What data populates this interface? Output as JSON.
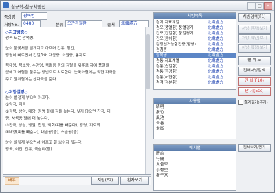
{
  "window": {
    "title": "침구학-침구처방집",
    "minimize": "_",
    "maximize": "□",
    "close": "×"
  },
  "form": {
    "name_label": "증상명",
    "name_value": "광목병",
    "no_label": "처방No.",
    "no_value": "0480",
    "category_label": "분류",
    "category_value": "오관과질환",
    "source_label": "출처",
    "source_value": "北織處方"
  },
  "content": {
    "sec1_title": "◇지표병증◇",
    "sec1_lines": [
      "광목 또는 광목병.",
      "눈이 불꽃처럼 빨개지고 아프며 간유, 행간,",
      "광명이 빠르면서 간열하며 대응증, 소원증, 통자로.",
      "목태양, 목소양, 수양명, 족궐음 경의 침혈을 위주로 하여 풍열을",
      "없애고 어혈을 풀주는 방법으로 치료한다. 눈국소혈에는 약한 자극을",
      "주고 원위혈에는 센자극을 준다."
    ],
    "sec2_title": "◇처방설명◇",
    "sec2_lines": [
      "눈이 벌겋게 부으며 아프다.",
      "①양곡, 지음",
      "②광목, 상양, 태양, 정명 혈에 침을 놓는다. 낮지 않으면 찬곡, 태",
      "양, 사목공 혈에 더 놓는다.",
      "③찬곡, 상성, 냉원, 천정, 백회(피를 빼준다), 광명, 지오회",
      "④태양(피를 빼준다), 대골공(뜸), 소골공(뜸)",
      "눈이 벌겋게 부으면서 아프고 잘 보이지 않는다.",
      "광목, 이간, 간유, 족삼리(침)"
    ]
  },
  "bottom": {
    "tag": "배우",
    "save_button": "저장(F2)",
    "list_button": "환자보기"
  },
  "list_panel": {
    "header": "처방목록",
    "rows": [
      {
        "name": "경기 지표계열",
        "source": "北織處方"
      },
      {
        "name": "경모(풍열형) 풍열경기",
        "source": "北織處方"
      },
      {
        "name": "간모(간열형) 풍열경기",
        "source": "北織處方"
      },
      {
        "name": "간모(음허형)",
        "source": "北織處方"
      },
      {
        "name": "감정선거능항진증(항병)",
        "source": "北織處方"
      },
      {
        "name": "검침증",
        "source": "北織處方"
      },
      {
        "name": "광목병",
        "source": "北織處方"
      },
      {
        "name": "경통 지표계열",
        "source": "北織處方"
      },
      {
        "name": "경통(습열형)",
        "source": "北織處方"
      },
      {
        "name": "경통(한경형)",
        "source": "北織處方"
      },
      {
        "name": "경통(허한형)",
        "source": "北織處方"
      },
      {
        "name": "경격(정분형)",
        "source": "北織處方"
      }
    ],
    "selected_index": 6
  },
  "points_panel": {
    "header": "사용혈",
    "items": [
      "睛明",
      "攢竹",
      "風池",
      "合谷",
      "太衝"
    ]
  },
  "mix_panel": {
    "header": "배치혈",
    "items": [
      "肝俞",
      "行間",
      "大骨空",
      "小骨空",
      "攢子宮"
    ]
  },
  "mix_toggle": "전체보기/접기",
  "side_buttons": {
    "reset": "처방검색(F1)",
    "b2": "처방(환자)보기",
    "b3": "처방(확인)보기",
    "b4": "처방(확장)보기",
    "detail": "혈 위 도",
    "search": "전체처방검색",
    "print": "인 쇄(F10)",
    "close": "닫 기(Esc)"
  },
  "check": {
    "label": "즐겨찾기(추가)"
  }
}
